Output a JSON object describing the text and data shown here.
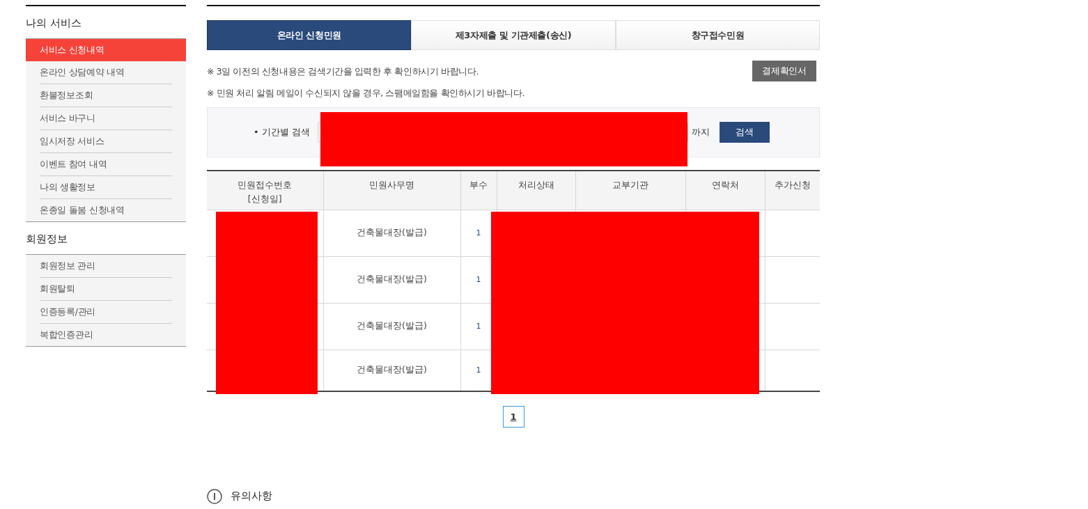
{
  "sidebar": {
    "sections": [
      {
        "title": "나의 서비스",
        "items": [
          {
            "label": "서비스 신청내역",
            "selected": true
          },
          {
            "label": "온라인 상담예약 내역",
            "selected": false
          },
          {
            "label": "환불정보조회",
            "selected": false
          },
          {
            "label": "서비스 바구니",
            "selected": false
          },
          {
            "label": "임시저장 서비스",
            "selected": false
          },
          {
            "label": "이벤트 참여 내역",
            "selected": false
          },
          {
            "label": "나의 생활정보",
            "selected": false
          },
          {
            "label": "온종일 돌봄 신청내역",
            "selected": false
          }
        ]
      },
      {
        "title": "회원정보",
        "items": [
          {
            "label": "회원정보 관리",
            "selected": false
          },
          {
            "label": "회원탈퇴",
            "selected": false
          },
          {
            "label": "인증등록/관리",
            "selected": false
          },
          {
            "label": "복합인증관리",
            "selected": false
          }
        ]
      }
    ]
  },
  "tabs": [
    {
      "label": "온라인 신청민원",
      "selected": true
    },
    {
      "label": "제3자제출 및 기관제출(송신)",
      "selected": false
    },
    {
      "label": "창구접수민원",
      "selected": false
    }
  ],
  "notices": [
    "※ 3일 이전의 신청내용은 검색기간을 입력한 후 확인하시기 바랍니다.",
    "※ 민원 처리 알림 메일이 수신되지 않을 경우, 스팸메일함을 확인하시기 바랍니다."
  ],
  "receipt_button": "결제확인서",
  "search": {
    "label": "• 기간별 검색",
    "redacted": true,
    "until": "까지",
    "button": "검색"
  },
  "table": {
    "columns": [
      {
        "label": "민원접수번호",
        "sublabel": "[신청일]",
        "redacted": true
      },
      {
        "label": "민원사무명",
        "redacted": false
      },
      {
        "label": "부수",
        "redacted": false
      },
      {
        "label": "처리상태",
        "redacted": true
      },
      {
        "label": "교부기관",
        "redacted": true
      },
      {
        "label": "연락처",
        "redacted": true
      },
      {
        "label": "추가신청",
        "redacted": false
      }
    ],
    "rows": [
      {
        "name": "건축물대장(발급)",
        "copies": "1"
      },
      {
        "name": "건축물대장(발급)",
        "copies": "1"
      },
      {
        "name": "건축물대장(발급)",
        "copies": "1"
      },
      {
        "name": "건축물대장(발급)",
        "copies": "1"
      }
    ]
  },
  "pagination": [
    {
      "label": "1",
      "selected": true
    }
  ],
  "caution": {
    "title": "유의사항"
  }
}
